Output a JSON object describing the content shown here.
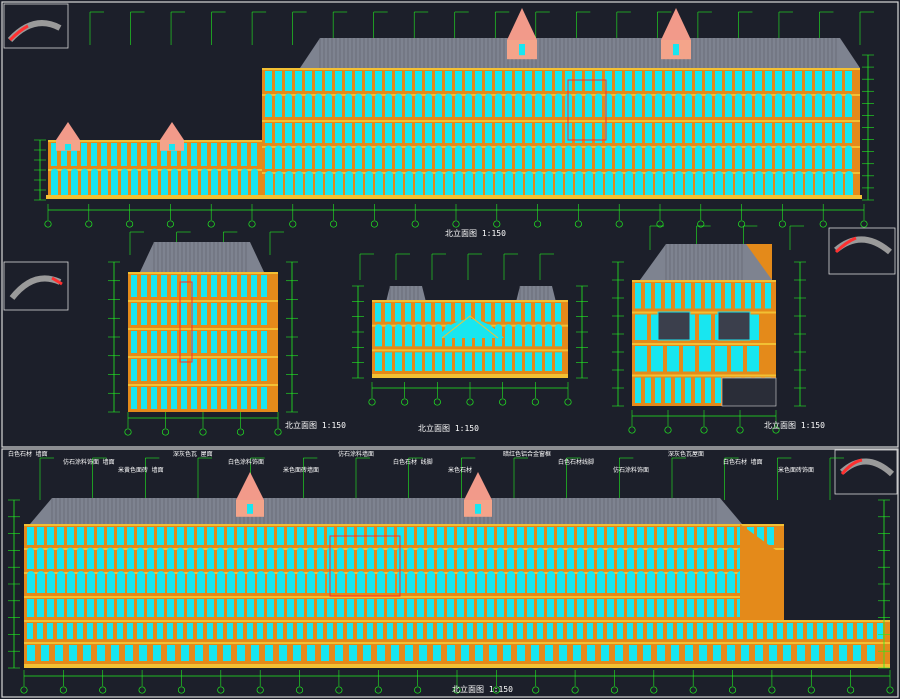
{
  "drawing": {
    "title_top": "北立面图 1:150",
    "title_side_left": "北立面图 1:150",
    "title_center": "北立面图 1:150",
    "title_side_right": "北立面图 1:150",
    "title_bottom": "北立面图 1:150"
  },
  "annotations": {
    "bottom_leaders": [
      "白色石材 墙面",
      "仿石涂料饰面 墙面",
      "米黄色面砖 墙面",
      "深灰色瓦 屋面",
      "白色涂料饰面",
      "米色面砖墙面",
      "仿石涂料墙面",
      "白色石材 线脚",
      "米色石材",
      "暗红色铝合金窗框",
      "白色石材线脚",
      "仿石涂料饰面",
      "深灰色瓦屋面",
      "白色石材 墙面",
      "米色面砖饰面"
    ]
  },
  "colors": {
    "background": "#1c1f2a",
    "frame": "#d8d8d8",
    "dim_green": "#22ee22",
    "roof_gray": "#7e8390",
    "wall_orange": "#e48a1a",
    "wall_yellow": "#f2c033",
    "window_cyan": "#18e6f0",
    "accent_red": "#ff2a2a",
    "text_white": "#ffffff"
  }
}
